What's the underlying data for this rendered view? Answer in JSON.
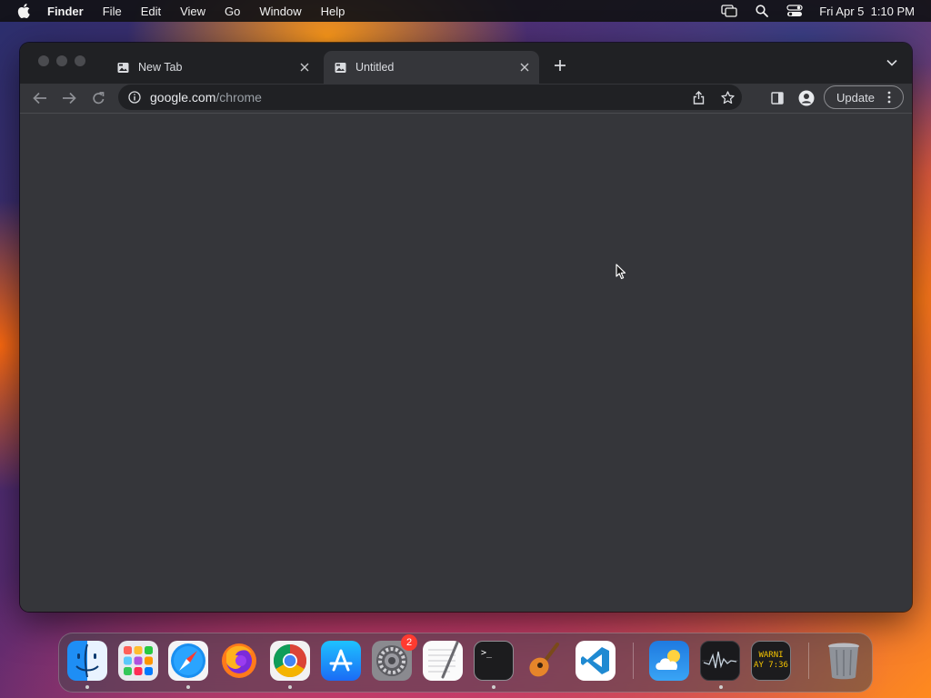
{
  "menubar": {
    "app_name": "Finder",
    "items": [
      "File",
      "Edit",
      "View",
      "Go",
      "Window",
      "Help"
    ],
    "datetime": "Fri Apr 5  1:10 PM",
    "status_icons": [
      "screen-mirroring-icon",
      "spotlight-search-icon",
      "control-center-icon"
    ]
  },
  "browser": {
    "tabs": [
      {
        "title": "New Tab",
        "active": false
      },
      {
        "title": "Untitled",
        "active": true
      }
    ],
    "address": {
      "host": "google.com",
      "path": "/chrome"
    },
    "update_label": "Update"
  },
  "dock": {
    "apps": [
      {
        "name": "Finder",
        "running": true
      },
      {
        "name": "Launchpad",
        "running": false
      },
      {
        "name": "Safari",
        "running": true
      },
      {
        "name": "Firefox",
        "running": false
      },
      {
        "name": "Google Chrome",
        "running": true
      },
      {
        "name": "App Store",
        "running": false
      },
      {
        "name": "System Settings",
        "running": false,
        "badge": "2"
      },
      {
        "name": "TextEdit",
        "running": false
      },
      {
        "name": "Terminal",
        "running": true,
        "label": ">_"
      },
      {
        "name": "GarageBand",
        "running": false
      },
      {
        "name": "Visual Studio Code",
        "running": false
      },
      {
        "name": "Weather",
        "running": false
      },
      {
        "name": "Activity Monitor",
        "running": true
      },
      {
        "name": "Console",
        "running": false,
        "label_line1": "WARNI",
        "label_line2": "AY 7:36"
      },
      {
        "name": "Trash",
        "running": false
      }
    ]
  },
  "colors": {
    "window_bg": "#35363a",
    "tabstrip_bg": "#202124",
    "badge": "#ff3b30"
  }
}
